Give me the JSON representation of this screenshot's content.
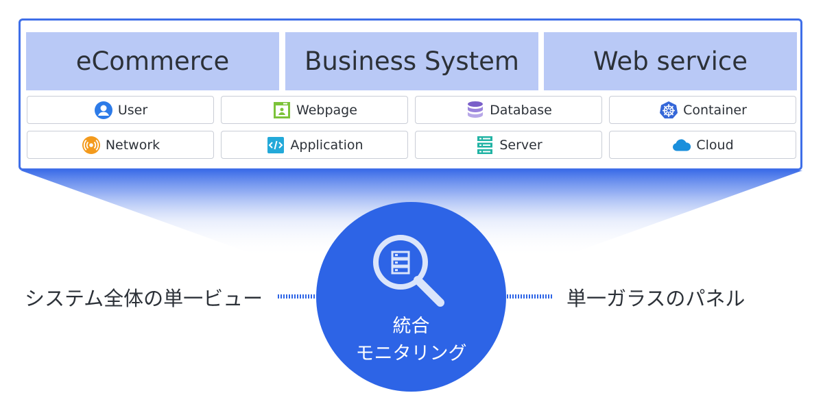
{
  "colors": {
    "accent": "#2d64e6",
    "panel_border": "#3e6ee8",
    "category_bg": "#b9c9f6"
  },
  "categories": [
    "eCommerce",
    "Business System",
    "Web service"
  ],
  "components": [
    {
      "label": "User",
      "icon": "user-icon"
    },
    {
      "label": "Webpage",
      "icon": "webpage-icon"
    },
    {
      "label": "Database",
      "icon": "database-icon"
    },
    {
      "label": "Container",
      "icon": "kubernetes-icon"
    },
    {
      "label": "Network",
      "icon": "network-icon"
    },
    {
      "label": "Application",
      "icon": "code-icon"
    },
    {
      "label": "Server",
      "icon": "server-icon"
    },
    {
      "label": "Cloud",
      "icon": "cloud-icon"
    }
  ],
  "hub": {
    "icon": "magnifier-server-icon",
    "line1": "統合",
    "line2": "モニタリング"
  },
  "left_label": "システム全体の単一ビュー",
  "right_label": "単一ガラスのパネル"
}
